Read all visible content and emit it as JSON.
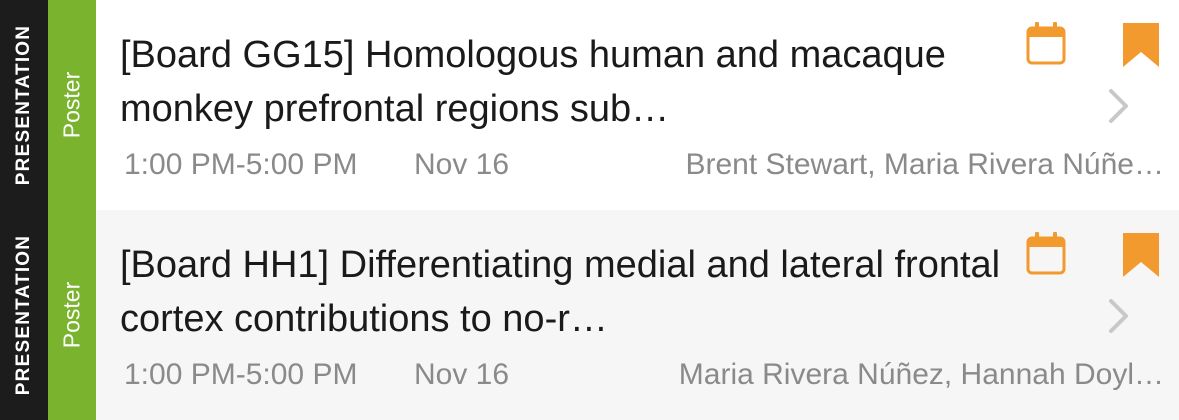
{
  "theme": {
    "kind_strip_color": "#1c1c1c",
    "type_strip_color": "#7ab32e",
    "accent_color": "#f39a2e",
    "chevron_color": "#c8c8c8"
  },
  "sessions": [
    {
      "kind": "PRESENTATION",
      "type": "Poster",
      "title": "[Board GG15] Homologous human and macaque monkey prefrontal regions sub…",
      "time": "1:00 PM-5:00 PM",
      "date": "Nov 16",
      "authors": "Brent Stewart, Maria Rivera Núñe…",
      "calendar_icon": "calendar-icon",
      "bookmark_icon": "bookmark-icon",
      "chevron_icon": "chevron-right-icon"
    },
    {
      "kind": "PRESENTATION",
      "type": "Poster",
      "title": "[Board HH1] Differentiating medial and lateral frontal cortex contributions to no-r…",
      "time": "1:00 PM-5:00 PM",
      "date": "Nov 16",
      "authors": "Maria Rivera Núñez, Hannah Doyl…",
      "calendar_icon": "calendar-icon",
      "bookmark_icon": "bookmark-icon",
      "chevron_icon": "chevron-right-icon"
    }
  ]
}
